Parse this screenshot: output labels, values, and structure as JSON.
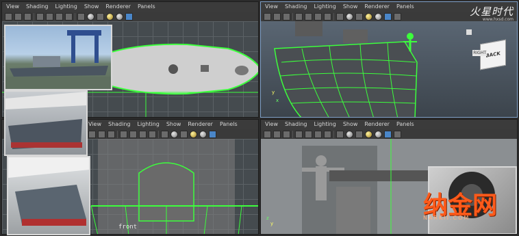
{
  "viewports": {
    "top": {
      "menu": [
        "View",
        "Shading",
        "Lighting",
        "Show",
        "Renderer",
        "Panels"
      ]
    },
    "persp": {
      "menu": [
        "View",
        "Shading",
        "Lighting",
        "Show",
        "Renderer",
        "Panels"
      ],
      "view_cube_top": "RIGHT",
      "view_cube_face": "BACK"
    },
    "front": {
      "menu": [
        "View",
        "Shading",
        "Lighting",
        "Show",
        "Renderer",
        "Panels"
      ],
      "label": "front"
    },
    "side": {
      "menu": [
        "View",
        "Shading",
        "Lighting",
        "Show",
        "Renderer",
        "Panels"
      ]
    }
  },
  "watermarks": {
    "top_logo": "火星时代",
    "top_url": "www.hxsd.com",
    "bottom_logo": "纳金网",
    "bottom_url": "NARKII.COM"
  },
  "colors": {
    "wireframe": "#3cff3c",
    "viewport_bg": "#454b4f",
    "menubar_bg": "#3b3b3b"
  }
}
